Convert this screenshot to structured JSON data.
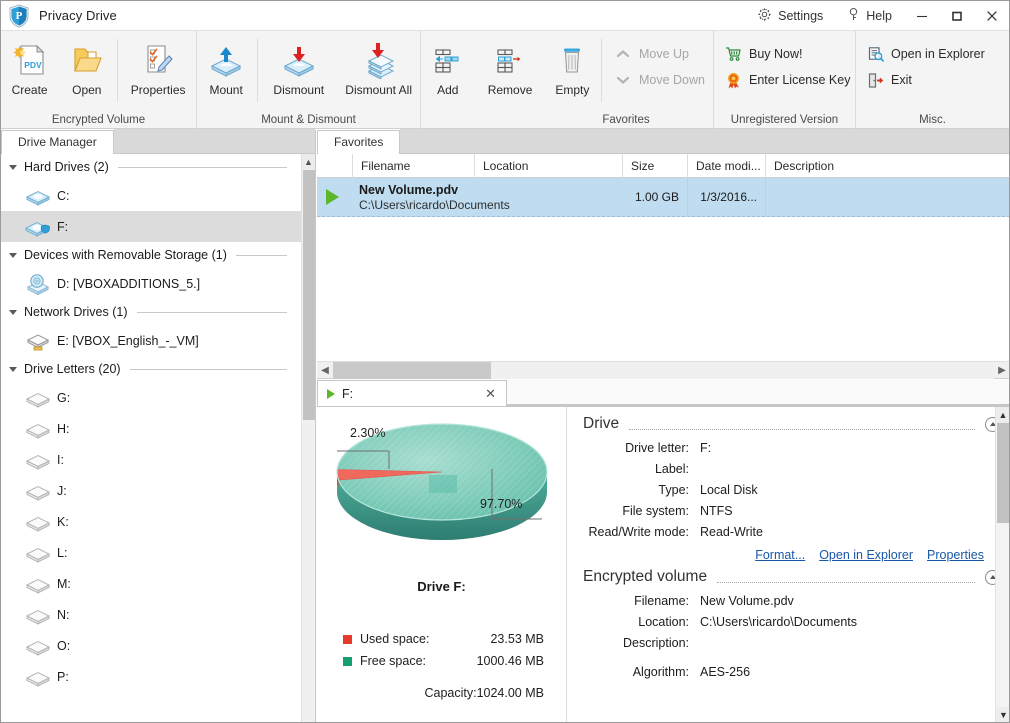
{
  "window": {
    "title": "Privacy Drive",
    "logo_icon": "shield-p-logo",
    "settings_label": "Settings",
    "settings_icon": "gear-icon",
    "help_label": "Help",
    "help_icon": "question-key-icon",
    "minimize_icon": "minimize-icon",
    "maximize_icon": "maximize-icon",
    "close_icon": "close-icon"
  },
  "ribbon": {
    "groups": [
      {
        "title": "Encrypted Volume",
        "buttons": [
          {
            "label": "Create",
            "icon": "new-pdv-document-icon"
          },
          {
            "label": "Open",
            "icon": "open-folder-icon"
          },
          {
            "label": "Properties",
            "icon": "properties-checklist-icon"
          }
        ]
      },
      {
        "title": "Mount & Dismount",
        "buttons": [
          {
            "label": "Mount",
            "icon": "mount-up-arrow-icon"
          },
          {
            "label": "Dismount",
            "icon": "dismount-down-arrow-icon"
          },
          {
            "label": "Dismount All",
            "icon": "dismount-all-stack-icon"
          }
        ]
      },
      {
        "title": "Favorites",
        "buttons": [
          {
            "label": "Add",
            "icon": "add-row-icon"
          },
          {
            "label": "Remove",
            "icon": "remove-row-icon"
          },
          {
            "label": "Empty",
            "icon": "trash-bin-icon"
          }
        ],
        "small_buttons": [
          {
            "label": "Move Up",
            "icon": "chevron-up-icon",
            "disabled": true
          },
          {
            "label": "Move Down",
            "icon": "chevron-down-icon",
            "disabled": true
          }
        ]
      },
      {
        "title": "Unregistered Version",
        "small_buttons": [
          {
            "label": "Buy Now!",
            "icon": "shopping-cart-icon",
            "disabled": false
          },
          {
            "label": "Enter License Key",
            "icon": "license-rosette-icon",
            "disabled": false
          }
        ]
      },
      {
        "title": "Misc.",
        "small_buttons": [
          {
            "label": "Open in Explorer",
            "icon": "explorer-search-icon",
            "disabled": false
          },
          {
            "label": "Exit",
            "icon": "exit-door-icon",
            "disabled": false
          }
        ]
      }
    ]
  },
  "sidebar": {
    "tab_label": "Drive Manager",
    "groups": [
      {
        "label": "Hard Drives (2)",
        "items": [
          {
            "label": "C:",
            "icon": "hard-drive-icon",
            "selected": false
          },
          {
            "label": "F:",
            "icon": "encrypted-drive-icon",
            "selected": true
          }
        ]
      },
      {
        "label": "Devices with Removable Storage (1)",
        "items": [
          {
            "label": "D: [VBOXADDITIONS_5.]",
            "icon": "optical-disc-icon",
            "selected": false
          }
        ]
      },
      {
        "label": "Network Drives (1)",
        "items": [
          {
            "label": "E: [VBOX_English_-_VM]",
            "icon": "network-drive-icon",
            "selected": false
          }
        ]
      },
      {
        "label": "Drive Letters (20)",
        "items": [
          {
            "label": "G:",
            "icon": "empty-drive-icon",
            "selected": false
          },
          {
            "label": "H:",
            "icon": "empty-drive-icon",
            "selected": false
          },
          {
            "label": "I:",
            "icon": "empty-drive-icon",
            "selected": false
          },
          {
            "label": "J:",
            "icon": "empty-drive-icon",
            "selected": false
          },
          {
            "label": "K:",
            "icon": "empty-drive-icon",
            "selected": false
          },
          {
            "label": "L:",
            "icon": "empty-drive-icon",
            "selected": false
          },
          {
            "label": "M:",
            "icon": "empty-drive-icon",
            "selected": false
          },
          {
            "label": "N:",
            "icon": "empty-drive-icon",
            "selected": false
          },
          {
            "label": "O:",
            "icon": "empty-drive-icon",
            "selected": false
          },
          {
            "label": "P:",
            "icon": "empty-drive-icon",
            "selected": false
          }
        ]
      }
    ]
  },
  "favorites": {
    "tab_label": "Favorites",
    "columns": [
      "Filename",
      "Location",
      "Size",
      "Date modi...",
      "Description"
    ],
    "rows": [
      {
        "status_icon": "mounted-play-icon",
        "filename": "New Volume.pdv",
        "path": "C:\\Users\\ricardo\\Documents",
        "location": "",
        "size": "1.00 GB",
        "date_modified": "1/3/2016...",
        "description": "",
        "selected": true
      }
    ]
  },
  "detail": {
    "tab_label": "F:",
    "tab_status_icon": "mounted-play-icon",
    "tab_close_icon": "close-icon",
    "chart_title": "Drive F:",
    "legend": [
      {
        "name": "Used space:",
        "value": "23.53 MB",
        "color": "#e8392a"
      },
      {
        "name": "Free space:",
        "value": "1000.46 MB",
        "color": "#16a071"
      }
    ],
    "capacity_label": "Capacity:",
    "capacity_value": "1024.00 MB",
    "sections": [
      {
        "title": "Drive",
        "collapse_icon": "collapse-up-icon",
        "rows": [
          {
            "key": "Drive letter:",
            "value": "F:"
          },
          {
            "key": "Label:",
            "value": ""
          },
          {
            "key": "Type:",
            "value": "Local Disk"
          },
          {
            "key": "File system:",
            "value": "NTFS"
          },
          {
            "key": "Read/Write mode:",
            "value": "Read-Write"
          }
        ],
        "links": [
          "Format...",
          "Open in Explorer",
          "Properties"
        ]
      },
      {
        "title": "Encrypted volume",
        "collapse_icon": "collapse-up-icon",
        "rows": [
          {
            "key": "Filename:",
            "value": "New Volume.pdv"
          },
          {
            "key": "Location:",
            "value": "C:\\Users\\ricardo\\Documents"
          },
          {
            "key": "Description:",
            "value": ""
          },
          {
            "key": "Algorithm:",
            "value": "AES-256"
          }
        ],
        "links": []
      }
    ]
  },
  "chart_data": {
    "type": "pie",
    "title": "Drive F:",
    "categories": [
      "Used space",
      "Free space"
    ],
    "values": [
      23.53,
      1000.46
    ],
    "unit": "MB",
    "percent_labels": [
      "2.30%",
      "97.70%"
    ],
    "colors": [
      "#e8392a",
      "#16a071"
    ],
    "total": 1024.0,
    "total_label": "Capacity:",
    "legend_position": "bottom",
    "grid": false,
    "style": "3d-pie"
  }
}
